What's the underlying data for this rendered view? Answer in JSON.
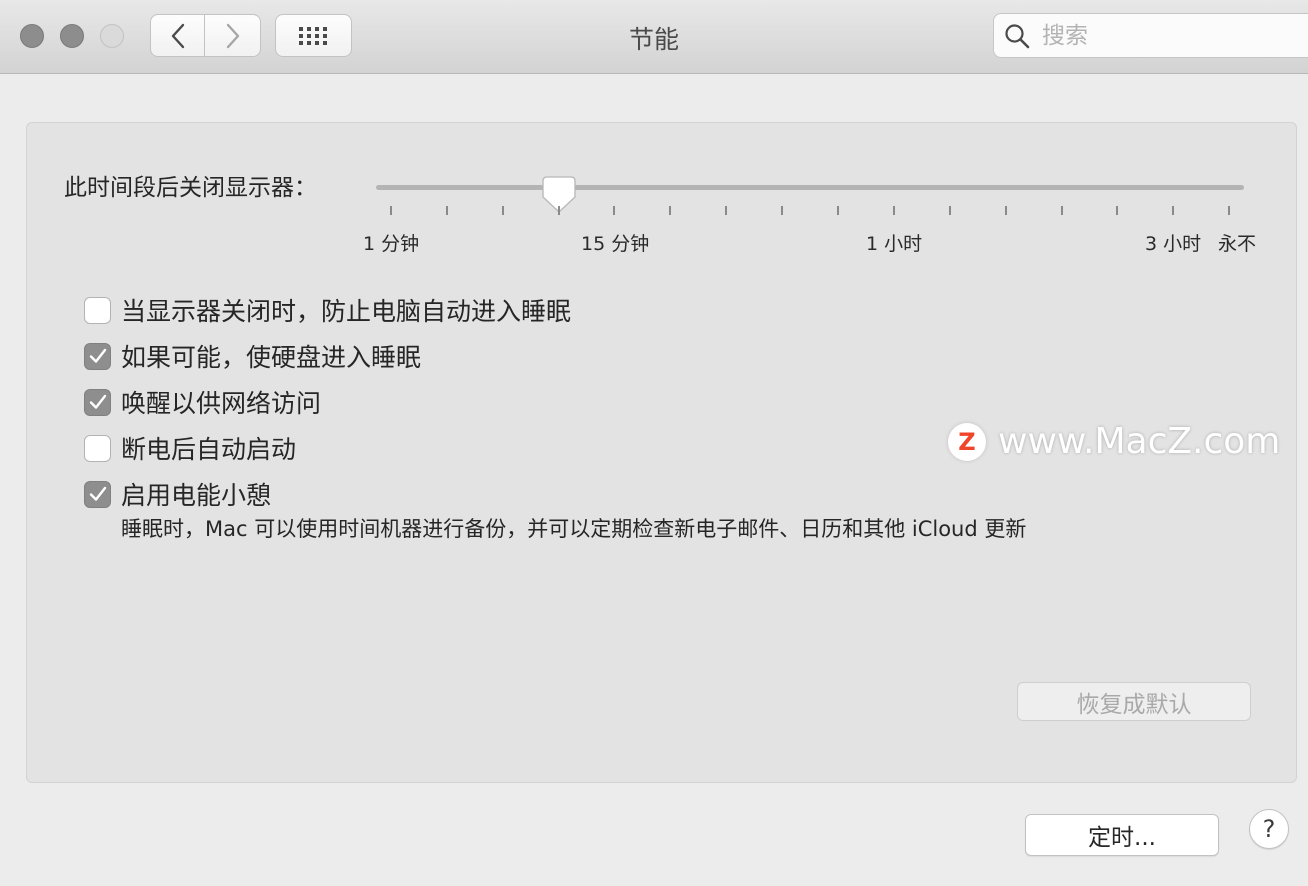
{
  "window": {
    "title": "节能"
  },
  "toolbar": {
    "back_icon": "chevron-left-icon",
    "forward_icon": "chevron-right-icon",
    "grid_icon": "grid-icon"
  },
  "search": {
    "placeholder": "搜索",
    "icon": "search-icon"
  },
  "display_sleep": {
    "label": "此时间段后关闭显示器：",
    "value": "10 分钟",
    "ticks": [
      "1 分钟",
      "15 分钟",
      "1 小时",
      "3 小时",
      "永不"
    ]
  },
  "options": [
    {
      "label": "当显示器关闭时，防止电脑自动进入睡眠",
      "checked": false
    },
    {
      "label": "如果可能，使硬盘进入睡眠",
      "checked": true
    },
    {
      "label": "唤醒以供网络访问",
      "checked": true
    },
    {
      "label": "断电后自动启动",
      "checked": false
    },
    {
      "label": "启用电能小憩",
      "checked": true
    }
  ],
  "power_nap_description": "睡眠时，Mac 可以使用时间机器进行备份，并可以定期检查新电子邮件、日历和其他 iCloud 更新",
  "buttons": {
    "restore_defaults": "恢复成默认",
    "schedule": "定时...",
    "help": "?"
  },
  "watermark": {
    "logo_letter": "Z",
    "text": "www.MacZ.com"
  },
  "colors": {
    "checkbox_checked": "#8e8e8e",
    "watermark_logo": "#f0452a"
  }
}
